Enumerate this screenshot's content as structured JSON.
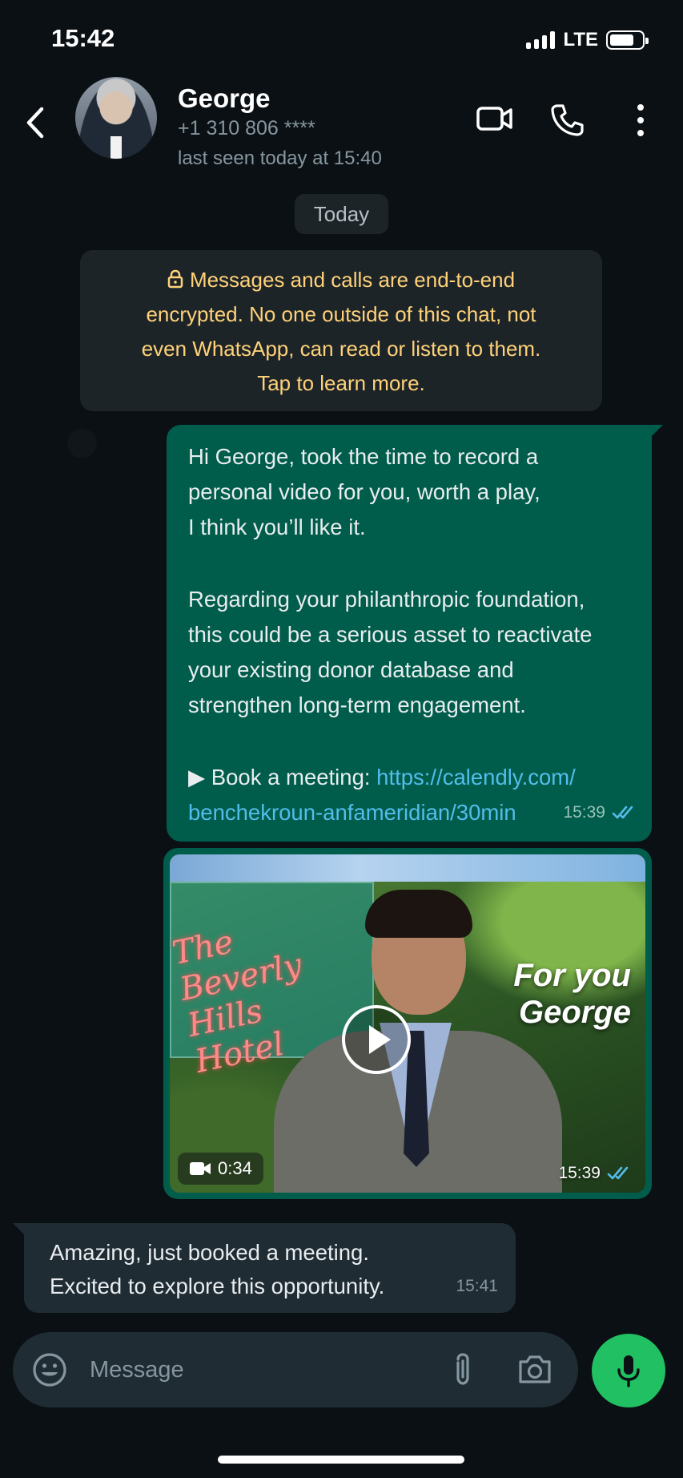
{
  "status_bar": {
    "time": "15:42",
    "network": "LTE"
  },
  "header": {
    "name": "George",
    "phone": "+1 310 806 ****",
    "last_seen": "last seen today at 15:40"
  },
  "date_chip": "Today",
  "encryption_notice": {
    "line1": "Messages and calls are end-to-end",
    "line2": "encrypted. No one outside of this chat, not",
    "line3": "even WhatsApp, can read or listen to them.",
    "line4": "Tap to learn more."
  },
  "outgoing_message": {
    "line1": "Hi George, took the time to record a",
    "line2": "personal video for you, worth a play,",
    "line3": "I think you’ll like it.",
    "line4": "Regarding your philanthropic foundation,",
    "line5": "this could be a serious asset to reactivate",
    "line6": "your existing donor database and",
    "line7": "strengthen long-term engagement.",
    "book_prefix": "▶ Book a meeting: ",
    "link_part1": "https://calendly.com/",
    "link_part2": "benchekroun-anfameridian/30min",
    "time": "15:39"
  },
  "video_message": {
    "overlay_line1": "For you",
    "overlay_line2": "George",
    "sign_line1": "The",
    "sign_line2": "Beverly Hills",
    "sign_line3": "Hotel",
    "duration": "0:34",
    "time": "15:39"
  },
  "incoming_message": {
    "line1": "Amazing, just booked a meeting.",
    "line2": "Excited to explore this opportunity.",
    "time": "15:41"
  },
  "composer": {
    "placeholder": "Message"
  },
  "colors": {
    "background": "#0b1014",
    "outgoing_bubble": "#005c4b",
    "incoming_bubble": "#1f2c34",
    "encryption_text": "#ffd279",
    "link": "#53bdeb",
    "mic_button": "#21c063",
    "read_ticks": "#53bdeb"
  }
}
